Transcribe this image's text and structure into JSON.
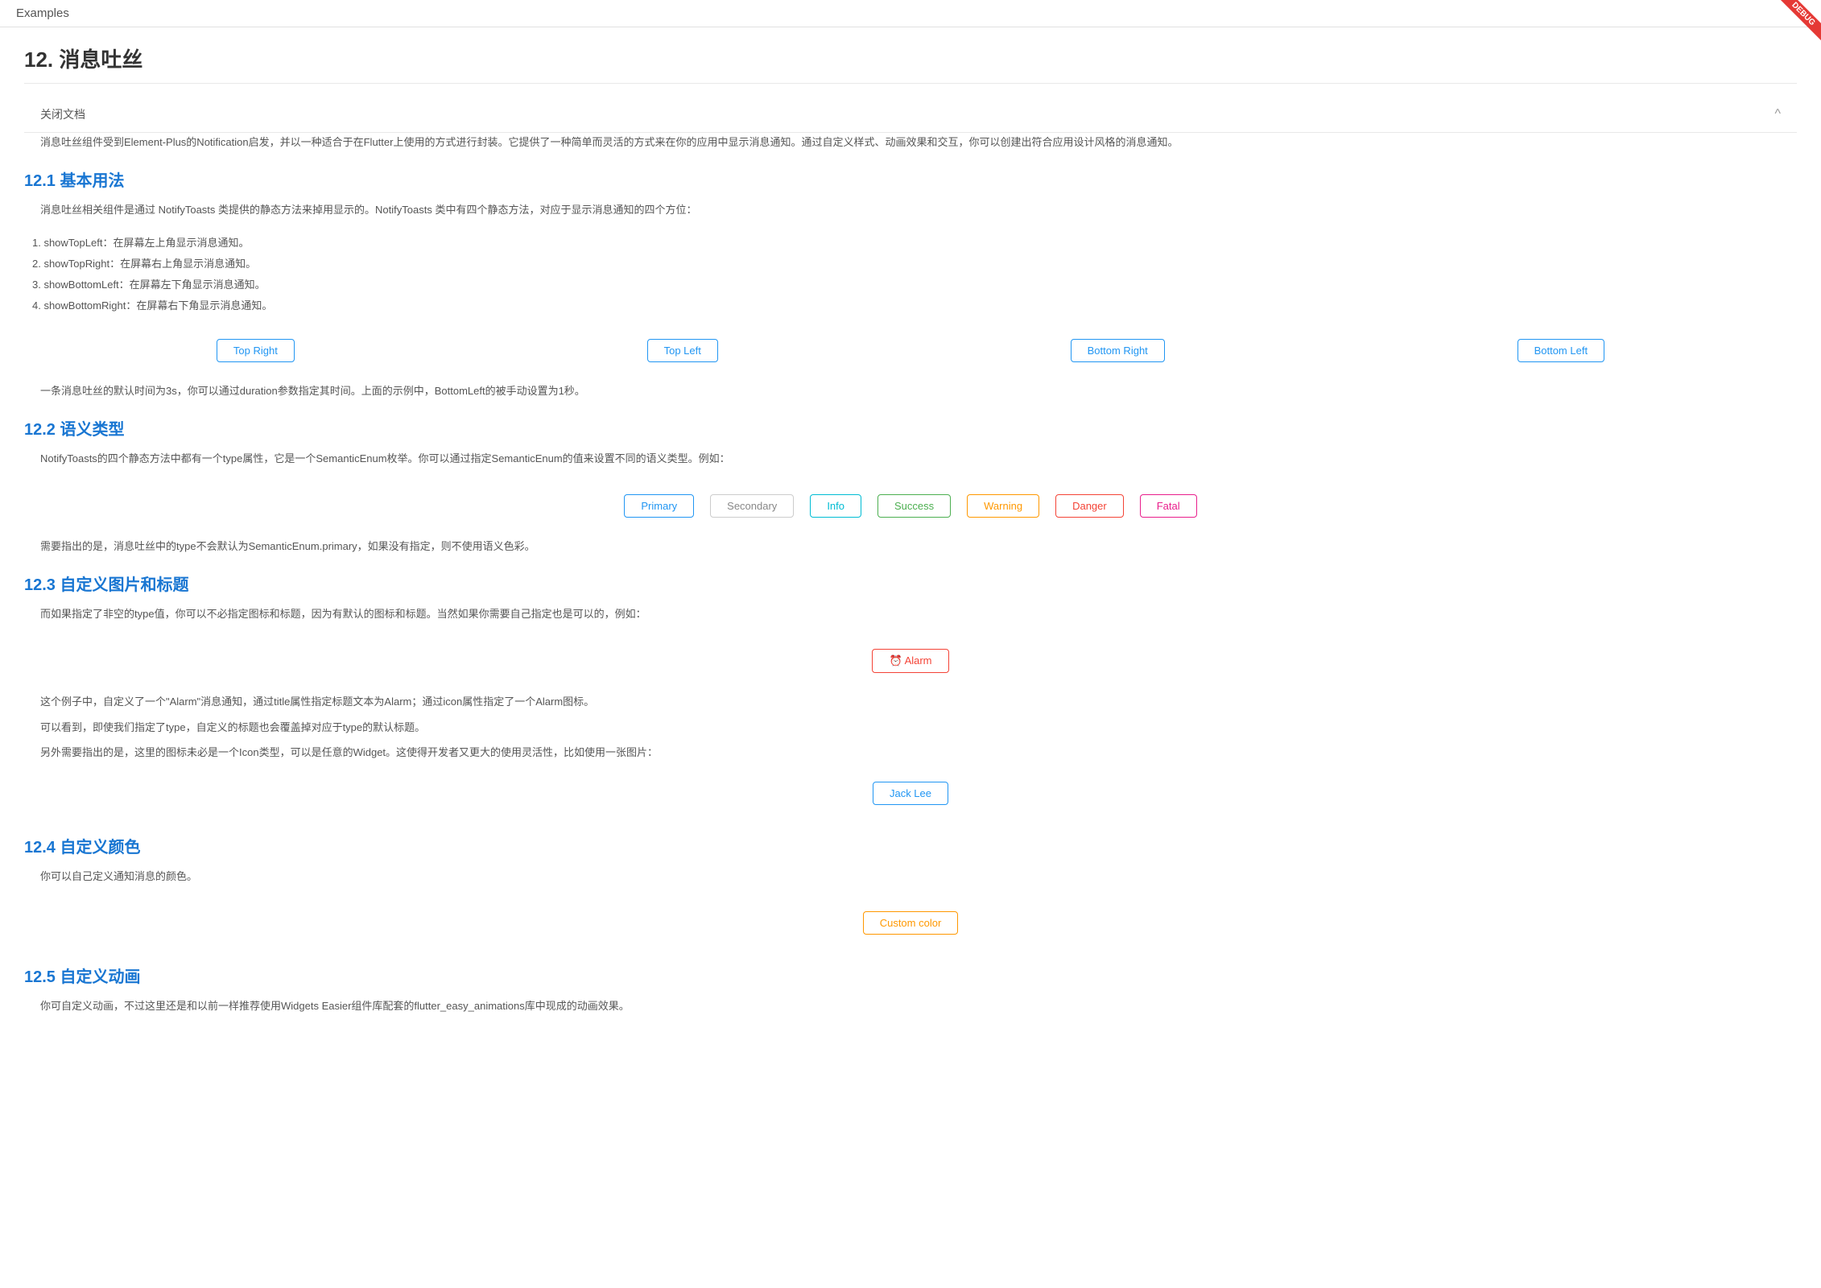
{
  "topbar": {
    "title": "Examples",
    "debug_label": "DEBUG"
  },
  "section": {
    "header": "关闭文档",
    "chevron": "^"
  },
  "page": {
    "title": "12. 消息吐丝",
    "description": "消息吐丝组件受到Element-Plus的Notification启发，并以一种适合于在Flutter上使用的方式进行封装。它提供了一种简单而灵活的方式来在你的应用中显示消息通知。通过自定义样式、动画效果和交互，你可以创建出符合应用设计风格的消息通知。"
  },
  "section12_1": {
    "title": "12.1 基本用法",
    "description": "消息吐丝相关组件是通过 NotifyToasts 类提供的静态方法来掉用显示的。NotifyToasts 类中有四个静态方法，对应于显示消息通知的四个方位：",
    "list_items": [
      "1. showTopLeft：在屏幕左上角显示消息通知。",
      "2. showTopRight：在屏幕右上角显示消息通知。",
      "3. showBottomLeft：在屏幕左下角显示消息通知。",
      "4. showBottomRight：在屏幕右下角显示消息通知。"
    ],
    "buttons": {
      "top_right": "Top Right",
      "top_left": "Top Left",
      "bottom_right": "Bottom Right",
      "bottom_left": "Bottom Left"
    },
    "note": "一条消息吐丝的默认时间为3s，你可以通过duration参数指定其时间。上面的示例中，BottomLeft的被手动设置为1秒。"
  },
  "section12_2": {
    "title": "12.2 语义类型",
    "description": "NotifyToasts的四个静态方法中都有一个type属性，它是一个SemanticEnum枚举。你可以通过指定SemanticEnum的值来设置不同的语义类型。例如：",
    "buttons": {
      "primary": "Primary",
      "secondary": "Secondary",
      "info": "Info",
      "success": "Success",
      "warning": "Warning",
      "danger": "Danger",
      "fatal": "Fatal"
    },
    "note": "需要指出的是，消息吐丝中的type不会默认为SemanticEnum.primary，如果没有指定，则不使用语义色彩。"
  },
  "section12_3": {
    "title": "12.3 自定义图片和标题",
    "description": "而如果指定了非空的type值，你可以不必指定图标和标题，因为有默认的图标和标题。当然如果你需要自己指定也是可以的，例如：",
    "alarm_button": "Alarm",
    "alarm_icon": "⏰",
    "notes": [
      "这个例子中，自定义了一个\"Alarm\"消息通知，通过title属性指定标题文本为Alarm；通过icon属性指定了一个Alarm图标。",
      "可以看到，即使我们指定了type，自定义的标题也会覆盖掉对应于type的默认标题。",
      "另外需要指出的是，这里的图标未必是一个Icon类型，可以是任意的Widget。这使得开发者又更大的使用灵活性，比如使用一张图片："
    ],
    "jacklee_button": "Jack Lee"
  },
  "section12_4": {
    "title": "12.4 自定义颜色",
    "description": "你可以自己定义通知消息的颜色。",
    "custom_button": "Custom color"
  },
  "section12_5": {
    "title": "12.5 自定义动画",
    "description": "你可自定义动画，不过这里还是和以前一样推荐使用Widgets Easier组件库配套的flutter_easy_animations库中现成的动画效果。"
  }
}
